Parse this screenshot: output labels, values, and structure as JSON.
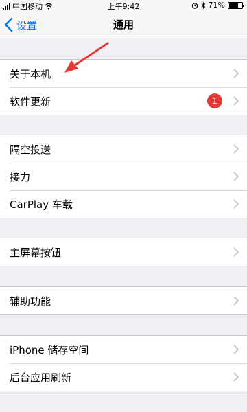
{
  "status_bar": {
    "carrier": "中国移动",
    "time": "上午9:42",
    "battery": "71%",
    "battery_level": 0.71
  },
  "nav": {
    "back_label": "设置",
    "title": "通用"
  },
  "groups": [
    {
      "items": [
        {
          "label": "关于本机"
        },
        {
          "label": "软件更新",
          "badge": "1"
        }
      ]
    },
    {
      "items": [
        {
          "label": "隔空投送"
        },
        {
          "label": "接力"
        },
        {
          "label": "CarPlay 车载"
        }
      ]
    },
    {
      "items": [
        {
          "label": "主屏幕按钮"
        }
      ]
    },
    {
      "items": [
        {
          "label": "辅助功能"
        }
      ]
    },
    {
      "items": [
        {
          "label": "iPhone 储存空间"
        },
        {
          "label": "后台应用刷新"
        }
      ]
    }
  ],
  "colors": {
    "accent": "#007aff",
    "badge": "#e53935",
    "annotation_arrow": "#e53935",
    "background": "#efeff4"
  },
  "icons": [
    "signal-icon",
    "wifi-icon",
    "alarm-icon",
    "bluetooth-icon",
    "battery-icon",
    "back-chevron-icon",
    "chevron-right-icon"
  ]
}
